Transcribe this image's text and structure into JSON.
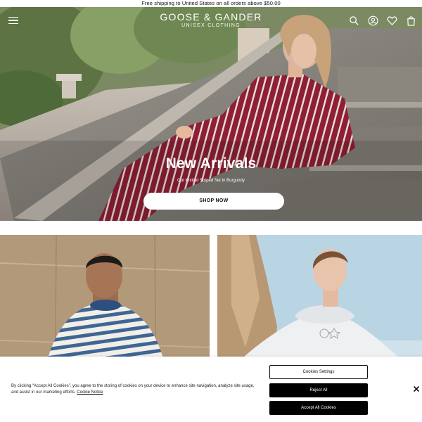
{
  "announcement": "Free shipping to United States on all orders above $50.00",
  "header": {
    "brand_name": "GOOSE & GANDER",
    "brand_sub": "UNISEX CLOTHING",
    "icons": [
      "menu-icon",
      "search-icon",
      "account-icon",
      "wishlist-icon",
      "cart-icon"
    ]
  },
  "hero": {
    "title": "New Arrivals",
    "subtitle": "Our Knitted Striped Set In Burgundy",
    "button": "SHOP NOW"
  },
  "cookie_banner": {
    "text": "By clicking “Accept All Cookies”, you agree to the storing of cookies on your device to enhance site navigation, analyze site usage, and assist in our marketing efforts.",
    "notice_link": "Cookie Notice",
    "settings_button": "Cookies Settings",
    "reject_button": "Reject All",
    "accept_button": "Accept All Cookies"
  },
  "colors": {
    "burgundy": "#8e1f35",
    "button_black": "#000000",
    "sky": "#b9d5e4",
    "stone": "#b59e80"
  }
}
